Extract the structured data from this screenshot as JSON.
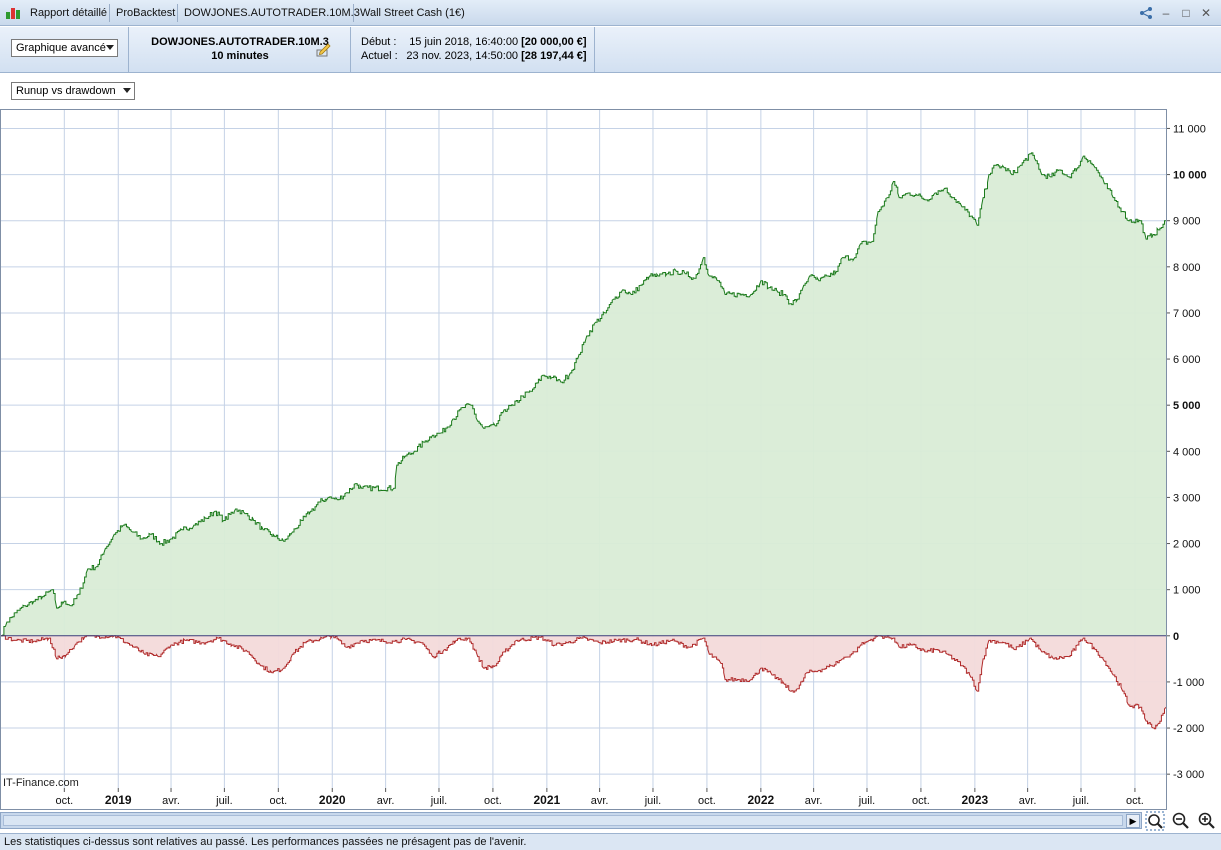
{
  "window": {
    "tabs": [
      "Rapport détaillé",
      "ProBacktest",
      "DOWJONES.AUTOTRADER.10M.3",
      "Wall Street Cash (1€)"
    ]
  },
  "header": {
    "view_select": "Graphique avancé",
    "instrument_name": "DOWJONES.AUTOTRADER.10M.3",
    "timeframe": "10 minutes",
    "start_label": "Début :",
    "start_date": "15 juin 2018, 16:40:00",
    "start_capital": "[20 000,00 €]",
    "current_label": "Actuel :",
    "current_date": "23 nov. 2023, 14:50:00",
    "current_capital": "[28 197,44 €]"
  },
  "chart_select": "Runup vs drawdown",
  "watermark": "IT-Finance.com",
  "status_text": "Les statistiques ci-dessus sont relatives au passé. Les performances passées ne présagent pas de l'avenir.",
  "chart_data": {
    "type": "area",
    "ylim": [
      -3300,
      11400
    ],
    "y_ticks": [
      {
        "v": 11000,
        "label": "11 000",
        "bold": false
      },
      {
        "v": 10000,
        "label": "10 000",
        "bold": true
      },
      {
        "v": 9000,
        "label": "9 000",
        "bold": false
      },
      {
        "v": 8000,
        "label": "8 000",
        "bold": false
      },
      {
        "v": 7000,
        "label": "7 000",
        "bold": false
      },
      {
        "v": 6000,
        "label": "6 000",
        "bold": false
      },
      {
        "v": 5000,
        "label": "5 000",
        "bold": true
      },
      {
        "v": 4000,
        "label": "4 000",
        "bold": false
      },
      {
        "v": 3000,
        "label": "3 000",
        "bold": false
      },
      {
        "v": 2000,
        "label": "2 000",
        "bold": false
      },
      {
        "v": 1000,
        "label": "1 000",
        "bold": false
      },
      {
        "v": 0,
        "label": "0",
        "bold": true
      },
      {
        "v": -1000,
        "label": "-1 000",
        "bold": false
      },
      {
        "v": -2000,
        "label": "-2 000",
        "bold": false
      },
      {
        "v": -3000,
        "label": "-3 000",
        "bold": false
      }
    ],
    "x_start": "2018-06-15",
    "x_end": "2023-11-23",
    "x_ticks": [
      {
        "date": "2018-10-01",
        "label": "oct.",
        "bold": false
      },
      {
        "date": "2019-01-01",
        "label": "2019",
        "bold": true
      },
      {
        "date": "2019-04-01",
        "label": "avr.",
        "bold": false
      },
      {
        "date": "2019-07-01",
        "label": "juil.",
        "bold": false
      },
      {
        "date": "2019-10-01",
        "label": "oct.",
        "bold": false
      },
      {
        "date": "2020-01-01",
        "label": "2020",
        "bold": true
      },
      {
        "date": "2020-04-01",
        "label": "avr.",
        "bold": false
      },
      {
        "date": "2020-07-01",
        "label": "juil.",
        "bold": false
      },
      {
        "date": "2020-10-01",
        "label": "oct.",
        "bold": false
      },
      {
        "date": "2021-01-01",
        "label": "2021",
        "bold": true
      },
      {
        "date": "2021-04-01",
        "label": "avr.",
        "bold": false
      },
      {
        "date": "2021-07-01",
        "label": "juil.",
        "bold": false
      },
      {
        "date": "2021-10-01",
        "label": "oct.",
        "bold": false
      },
      {
        "date": "2022-01-01",
        "label": "2022",
        "bold": true
      },
      {
        "date": "2022-04-01",
        "label": "avr.",
        "bold": false
      },
      {
        "date": "2022-07-01",
        "label": "juil.",
        "bold": false
      },
      {
        "date": "2022-10-01",
        "label": "oct.",
        "bold": false
      },
      {
        "date": "2023-01-01",
        "label": "2023",
        "bold": true
      },
      {
        "date": "2023-04-01",
        "label": "avr.",
        "bold": false
      },
      {
        "date": "2023-07-01",
        "label": "juil.",
        "bold": false
      },
      {
        "date": "2023-10-01",
        "label": "oct.",
        "bold": false
      }
    ],
    "series": [
      {
        "color": "#1b7a1b",
        "fill": "#d9ecd6",
        "points": [
          [
            "2018-06-15",
            0
          ],
          [
            "2018-06-25",
            300
          ],
          [
            "2018-07-10",
            500
          ],
          [
            "2018-07-25",
            650
          ],
          [
            "2018-08-10",
            750
          ],
          [
            "2018-08-25",
            850
          ],
          [
            "2018-09-10",
            1000
          ],
          [
            "2018-09-18",
            600
          ],
          [
            "2018-10-01",
            750
          ],
          [
            "2018-10-12",
            650
          ],
          [
            "2018-10-25",
            900
          ],
          [
            "2018-11-10",
            1450
          ],
          [
            "2018-11-25",
            1500
          ],
          [
            "2018-12-10",
            1900
          ],
          [
            "2018-12-25",
            2200
          ],
          [
            "2019-01-10",
            2400
          ],
          [
            "2019-01-25",
            2250
          ],
          [
            "2019-02-10",
            2100
          ],
          [
            "2019-02-25",
            2200
          ],
          [
            "2019-03-15",
            2000
          ],
          [
            "2019-04-01",
            2100
          ],
          [
            "2019-04-20",
            2300
          ],
          [
            "2019-05-10",
            2400
          ],
          [
            "2019-05-30",
            2550
          ],
          [
            "2019-06-15",
            2700
          ],
          [
            "2019-06-30",
            2500
          ],
          [
            "2019-07-20",
            2750
          ],
          [
            "2019-08-05",
            2650
          ],
          [
            "2019-08-20",
            2500
          ],
          [
            "2019-09-05",
            2300
          ],
          [
            "2019-09-25",
            2150
          ],
          [
            "2019-10-10",
            2050
          ],
          [
            "2019-10-25",
            2250
          ],
          [
            "2019-11-10",
            2500
          ],
          [
            "2019-11-25",
            2700
          ],
          [
            "2019-12-10",
            2900
          ],
          [
            "2019-12-25",
            3000
          ],
          [
            "2020-01-10",
            2950
          ],
          [
            "2020-01-25",
            3100
          ],
          [
            "2020-02-10",
            3300
          ],
          [
            "2020-02-20",
            3200
          ],
          [
            "2020-04-15",
            3200
          ],
          [
            "2020-04-20",
            3700
          ],
          [
            "2020-05-05",
            3900
          ],
          [
            "2020-05-20",
            4000
          ],
          [
            "2020-06-05",
            4200
          ],
          [
            "2020-06-20",
            4350
          ],
          [
            "2020-07-05",
            4400
          ],
          [
            "2020-07-25",
            4700
          ],
          [
            "2020-08-10",
            4950
          ],
          [
            "2020-08-25",
            5000
          ],
          [
            "2020-09-05",
            4650
          ],
          [
            "2020-09-15",
            4500
          ],
          [
            "2020-10-05",
            4550
          ],
          [
            "2020-10-20",
            4900
          ],
          [
            "2020-11-05",
            5000
          ],
          [
            "2020-11-20",
            5200
          ],
          [
            "2020-12-05",
            5300
          ],
          [
            "2020-12-25",
            5650
          ],
          [
            "2021-01-10",
            5600
          ],
          [
            "2021-01-25",
            5500
          ],
          [
            "2021-02-10",
            5700
          ],
          [
            "2021-02-25",
            6100
          ],
          [
            "2021-03-10",
            6500
          ],
          [
            "2021-03-25",
            6800
          ],
          [
            "2021-04-10",
            7000
          ],
          [
            "2021-04-25",
            7300
          ],
          [
            "2021-05-10",
            7500
          ],
          [
            "2021-05-25",
            7400
          ],
          [
            "2021-06-10",
            7600
          ],
          [
            "2021-06-25",
            7800
          ],
          [
            "2021-07-10",
            7800
          ],
          [
            "2021-07-25",
            7850
          ],
          [
            "2021-08-10",
            7900
          ],
          [
            "2021-08-25",
            7850
          ],
          [
            "2021-09-10",
            7750
          ],
          [
            "2021-09-25",
            8200
          ],
          [
            "2021-10-05",
            7800
          ],
          [
            "2021-10-20",
            7700
          ],
          [
            "2021-11-01",
            7400
          ],
          [
            "2021-12-15",
            7400
          ],
          [
            "2022-01-01",
            7700
          ],
          [
            "2022-01-15",
            7550
          ],
          [
            "2022-01-30",
            7450
          ],
          [
            "2022-02-10",
            7400
          ],
          [
            "2022-02-20",
            7200
          ],
          [
            "2022-03-05",
            7300
          ],
          [
            "2022-03-15",
            7600
          ],
          [
            "2022-03-25",
            7800
          ],
          [
            "2022-04-10",
            7700
          ],
          [
            "2022-04-25",
            7800
          ],
          [
            "2022-05-10",
            7900
          ],
          [
            "2022-05-20",
            8200
          ],
          [
            "2022-06-10",
            8200
          ],
          [
            "2022-06-20",
            8500
          ],
          [
            "2022-07-10",
            8550
          ],
          [
            "2022-07-20",
            9200
          ],
          [
            "2022-08-05",
            9500
          ],
          [
            "2022-08-15",
            9850
          ],
          [
            "2022-08-25",
            9500
          ],
          [
            "2022-09-10",
            9600
          ],
          [
            "2022-09-25",
            9550
          ],
          [
            "2022-10-10",
            9450
          ],
          [
            "2022-10-25",
            9600
          ],
          [
            "2022-11-10",
            9700
          ],
          [
            "2022-11-25",
            9500
          ],
          [
            "2022-12-10",
            9300
          ],
          [
            "2022-12-25",
            9100
          ],
          [
            "2023-01-05",
            8900
          ],
          [
            "2023-01-15",
            9500
          ],
          [
            "2023-01-25",
            10000
          ],
          [
            "2023-02-05",
            10200
          ],
          [
            "2023-02-20",
            10150
          ],
          [
            "2023-03-05",
            10000
          ],
          [
            "2023-03-20",
            10200
          ],
          [
            "2023-04-05",
            10450
          ],
          [
            "2023-04-15",
            10300
          ],
          [
            "2023-04-25",
            10000
          ],
          [
            "2023-05-10",
            9950
          ],
          [
            "2023-05-25",
            10100
          ],
          [
            "2023-06-10",
            9950
          ],
          [
            "2023-06-25",
            10150
          ],
          [
            "2023-07-05",
            10400
          ],
          [
            "2023-07-15",
            10300
          ],
          [
            "2023-07-25",
            10150
          ],
          [
            "2023-08-10",
            9800
          ],
          [
            "2023-08-25",
            9500
          ],
          [
            "2023-09-10",
            9200
          ],
          [
            "2023-09-20",
            9000
          ],
          [
            "2023-10-10",
            9000
          ],
          [
            "2023-10-20",
            8600
          ],
          [
            "2023-11-01",
            8700
          ],
          [
            "2023-11-10",
            8800
          ],
          [
            "2023-11-23",
            9000
          ]
        ]
      },
      {
        "color": "#b02a2a",
        "fill": "#f3dada",
        "points": [
          [
            "2018-06-15",
            0
          ],
          [
            "2018-07-10",
            -100
          ],
          [
            "2018-08-10",
            -120
          ],
          [
            "2018-09-05",
            -50
          ],
          [
            "2018-09-18",
            -500
          ],
          [
            "2018-10-05",
            -400
          ],
          [
            "2018-10-20",
            -180
          ],
          [
            "2018-11-05",
            -20
          ],
          [
            "2018-12-25",
            0
          ],
          [
            "2019-01-15",
            -150
          ],
          [
            "2019-02-15",
            -400
          ],
          [
            "2019-03-10",
            -450
          ],
          [
            "2019-04-01",
            -200
          ],
          [
            "2019-04-25",
            -100
          ],
          [
            "2019-05-25",
            -150
          ],
          [
            "2019-06-20",
            -50
          ],
          [
            "2019-07-15",
            -200
          ],
          [
            "2019-08-10",
            -350
          ],
          [
            "2019-09-01",
            -650
          ],
          [
            "2019-09-20",
            -800
          ],
          [
            "2019-10-10",
            -700
          ],
          [
            "2019-10-25",
            -400
          ],
          [
            "2019-11-15",
            -150
          ],
          [
            "2019-12-15",
            -50
          ],
          [
            "2020-01-01",
            0
          ],
          [
            "2020-01-25",
            -250
          ],
          [
            "2020-02-20",
            -100
          ],
          [
            "2020-04-15",
            -120
          ],
          [
            "2020-05-05",
            -80
          ],
          [
            "2020-06-01",
            -150
          ],
          [
            "2020-06-20",
            -450
          ],
          [
            "2020-07-10",
            -300
          ],
          [
            "2020-07-30",
            -100
          ],
          [
            "2020-08-20",
            -50
          ],
          [
            "2020-09-05",
            -450
          ],
          [
            "2020-09-15",
            -700
          ],
          [
            "2020-10-05",
            -650
          ],
          [
            "2020-10-20",
            -350
          ],
          [
            "2020-11-10",
            -100
          ],
          [
            "2020-12-20",
            -30
          ],
          [
            "2021-01-15",
            -200
          ],
          [
            "2021-02-05",
            -150
          ],
          [
            "2021-03-01",
            -50
          ],
          [
            "2021-04-01",
            -150
          ],
          [
            "2021-05-01",
            -100
          ],
          [
            "2021-06-01",
            -80
          ],
          [
            "2021-07-01",
            -200
          ],
          [
            "2021-08-01",
            -100
          ],
          [
            "2021-09-01",
            -250
          ],
          [
            "2021-09-25",
            -50
          ],
          [
            "2021-10-05",
            -400
          ],
          [
            "2021-10-25",
            -600
          ],
          [
            "2021-11-01",
            -950
          ],
          [
            "2021-12-15",
            -950
          ],
          [
            "2022-01-01",
            -700
          ],
          [
            "2022-01-20",
            -850
          ],
          [
            "2022-02-10",
            -1050
          ],
          [
            "2022-02-20",
            -1200
          ],
          [
            "2022-03-05",
            -1150
          ],
          [
            "2022-03-20",
            -800
          ],
          [
            "2022-04-10",
            -750
          ],
          [
            "2022-05-01",
            -650
          ],
          [
            "2022-05-20",
            -500
          ],
          [
            "2022-06-10",
            -350
          ],
          [
            "2022-06-20",
            -200
          ],
          [
            "2022-07-05",
            -100
          ],
          [
            "2022-07-20",
            0
          ],
          [
            "2022-08-15",
            -50
          ],
          [
            "2022-08-25",
            -250
          ],
          [
            "2022-09-15",
            -200
          ],
          [
            "2022-10-10",
            -350
          ],
          [
            "2022-10-25",
            -300
          ],
          [
            "2022-11-15",
            -400
          ],
          [
            "2022-12-10",
            -650
          ],
          [
            "2022-12-25",
            -900
          ],
          [
            "2023-01-05",
            -1200
          ],
          [
            "2023-01-15",
            -500
          ],
          [
            "2023-01-25",
            -100
          ],
          [
            "2023-02-20",
            -150
          ],
          [
            "2023-03-10",
            -300
          ],
          [
            "2023-04-05",
            -50
          ],
          [
            "2023-04-25",
            -350
          ],
          [
            "2023-05-15",
            -500
          ],
          [
            "2023-06-10",
            -450
          ],
          [
            "2023-06-25",
            -200
          ],
          [
            "2023-07-05",
            -50
          ],
          [
            "2023-07-25",
            -300
          ],
          [
            "2023-08-10",
            -550
          ],
          [
            "2023-08-25",
            -850
          ],
          [
            "2023-09-10",
            -1200
          ],
          [
            "2023-09-20",
            -1500
          ],
          [
            "2023-10-10",
            -1550
          ],
          [
            "2023-10-20",
            -1850
          ],
          [
            "2023-11-01",
            -2000
          ],
          [
            "2023-11-10",
            -1900
          ],
          [
            "2023-11-23",
            -1550
          ]
        ]
      }
    ]
  }
}
